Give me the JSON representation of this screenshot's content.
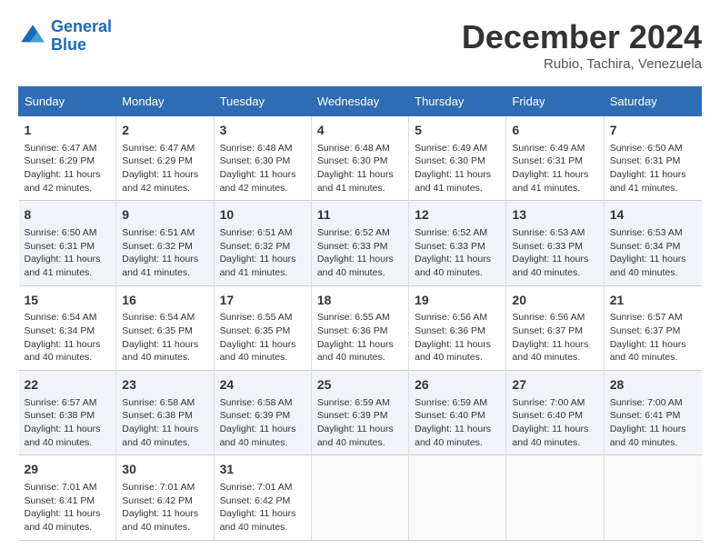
{
  "header": {
    "logo_line1": "General",
    "logo_line2": "Blue",
    "month": "December 2024",
    "location": "Rubio, Tachira, Venezuela"
  },
  "days_of_week": [
    "Sunday",
    "Monday",
    "Tuesday",
    "Wednesday",
    "Thursday",
    "Friday",
    "Saturday"
  ],
  "weeks": [
    [
      {
        "day": "1",
        "info": "Sunrise: 6:47 AM\nSunset: 6:29 PM\nDaylight: 11 hours and 42 minutes."
      },
      {
        "day": "2",
        "info": "Sunrise: 6:47 AM\nSunset: 6:29 PM\nDaylight: 11 hours and 42 minutes."
      },
      {
        "day": "3",
        "info": "Sunrise: 6:48 AM\nSunset: 6:30 PM\nDaylight: 11 hours and 42 minutes."
      },
      {
        "day": "4",
        "info": "Sunrise: 6:48 AM\nSunset: 6:30 PM\nDaylight: 11 hours and 41 minutes."
      },
      {
        "day": "5",
        "info": "Sunrise: 6:49 AM\nSunset: 6:30 PM\nDaylight: 11 hours and 41 minutes."
      },
      {
        "day": "6",
        "info": "Sunrise: 6:49 AM\nSunset: 6:31 PM\nDaylight: 11 hours and 41 minutes."
      },
      {
        "day": "7",
        "info": "Sunrise: 6:50 AM\nSunset: 6:31 PM\nDaylight: 11 hours and 41 minutes."
      }
    ],
    [
      {
        "day": "8",
        "info": "Sunrise: 6:50 AM\nSunset: 6:31 PM\nDaylight: 11 hours and 41 minutes."
      },
      {
        "day": "9",
        "info": "Sunrise: 6:51 AM\nSunset: 6:32 PM\nDaylight: 11 hours and 41 minutes."
      },
      {
        "day": "10",
        "info": "Sunrise: 6:51 AM\nSunset: 6:32 PM\nDaylight: 11 hours and 41 minutes."
      },
      {
        "day": "11",
        "info": "Sunrise: 6:52 AM\nSunset: 6:33 PM\nDaylight: 11 hours and 40 minutes."
      },
      {
        "day": "12",
        "info": "Sunrise: 6:52 AM\nSunset: 6:33 PM\nDaylight: 11 hours and 40 minutes."
      },
      {
        "day": "13",
        "info": "Sunrise: 6:53 AM\nSunset: 6:33 PM\nDaylight: 11 hours and 40 minutes."
      },
      {
        "day": "14",
        "info": "Sunrise: 6:53 AM\nSunset: 6:34 PM\nDaylight: 11 hours and 40 minutes."
      }
    ],
    [
      {
        "day": "15",
        "info": "Sunrise: 6:54 AM\nSunset: 6:34 PM\nDaylight: 11 hours and 40 minutes."
      },
      {
        "day": "16",
        "info": "Sunrise: 6:54 AM\nSunset: 6:35 PM\nDaylight: 11 hours and 40 minutes."
      },
      {
        "day": "17",
        "info": "Sunrise: 6:55 AM\nSunset: 6:35 PM\nDaylight: 11 hours and 40 minutes."
      },
      {
        "day": "18",
        "info": "Sunrise: 6:55 AM\nSunset: 6:36 PM\nDaylight: 11 hours and 40 minutes."
      },
      {
        "day": "19",
        "info": "Sunrise: 6:56 AM\nSunset: 6:36 PM\nDaylight: 11 hours and 40 minutes."
      },
      {
        "day": "20",
        "info": "Sunrise: 6:56 AM\nSunset: 6:37 PM\nDaylight: 11 hours and 40 minutes."
      },
      {
        "day": "21",
        "info": "Sunrise: 6:57 AM\nSunset: 6:37 PM\nDaylight: 11 hours and 40 minutes."
      }
    ],
    [
      {
        "day": "22",
        "info": "Sunrise: 6:57 AM\nSunset: 6:38 PM\nDaylight: 11 hours and 40 minutes."
      },
      {
        "day": "23",
        "info": "Sunrise: 6:58 AM\nSunset: 6:38 PM\nDaylight: 11 hours and 40 minutes."
      },
      {
        "day": "24",
        "info": "Sunrise: 6:58 AM\nSunset: 6:39 PM\nDaylight: 11 hours and 40 minutes."
      },
      {
        "day": "25",
        "info": "Sunrise: 6:59 AM\nSunset: 6:39 PM\nDaylight: 11 hours and 40 minutes."
      },
      {
        "day": "26",
        "info": "Sunrise: 6:59 AM\nSunset: 6:40 PM\nDaylight: 11 hours and 40 minutes."
      },
      {
        "day": "27",
        "info": "Sunrise: 7:00 AM\nSunset: 6:40 PM\nDaylight: 11 hours and 40 minutes."
      },
      {
        "day": "28",
        "info": "Sunrise: 7:00 AM\nSunset: 6:41 PM\nDaylight: 11 hours and 40 minutes."
      }
    ],
    [
      {
        "day": "29",
        "info": "Sunrise: 7:01 AM\nSunset: 6:41 PM\nDaylight: 11 hours and 40 minutes."
      },
      {
        "day": "30",
        "info": "Sunrise: 7:01 AM\nSunset: 6:42 PM\nDaylight: 11 hours and 40 minutes."
      },
      {
        "day": "31",
        "info": "Sunrise: 7:01 AM\nSunset: 6:42 PM\nDaylight: 11 hours and 40 minutes."
      },
      {
        "day": "",
        "info": ""
      },
      {
        "day": "",
        "info": ""
      },
      {
        "day": "",
        "info": ""
      },
      {
        "day": "",
        "info": ""
      }
    ]
  ]
}
